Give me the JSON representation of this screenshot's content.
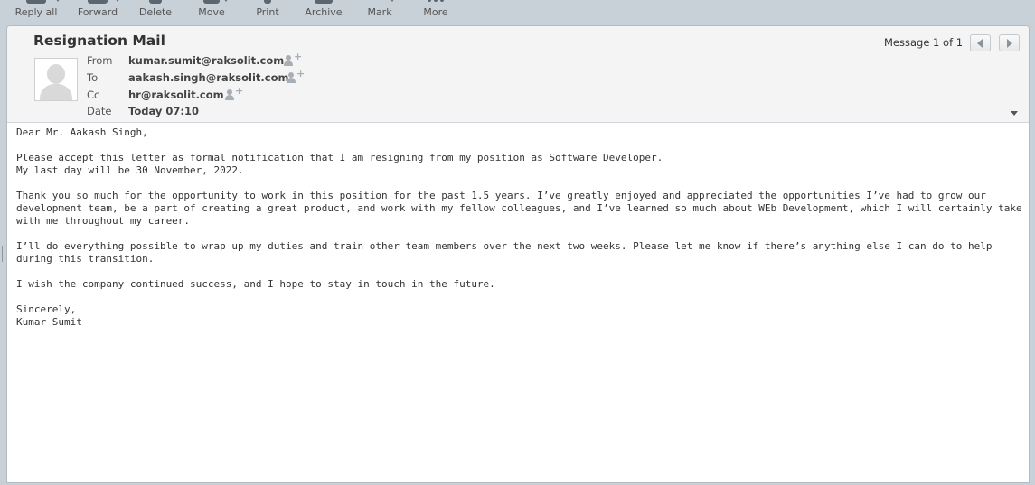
{
  "toolbar": {
    "reply_all": "Reply all",
    "forward": "Forward",
    "delete": "Delete",
    "move": "Move",
    "print": "Print",
    "archive": "Archive",
    "mark": "Mark",
    "more": "More"
  },
  "message": {
    "subject": "Resignation Mail",
    "counter": "Message 1 of 1",
    "labels": {
      "from": "From",
      "to": "To",
      "cc": "Cc",
      "date": "Date"
    },
    "from": "kumar.sumit@raksolit.com",
    "to": "aakash.singh@raksolit.com",
    "cc": "hr@raksolit.com",
    "date": "Today 07:10",
    "body": {
      "greeting": "Dear Mr. Aakash Singh,",
      "p1_line1": "Please accept this letter as formal notification that I am resigning from my position as Software Developer.",
      "p1_line2": "My last day will be 30 November, 2022.",
      "p2": "Thank you so much for the opportunity to work in this position for the past 1.5 years. I’ve greatly enjoyed and appreciated the opportunities I’ve had to grow our development team, be a part of creating a great product, and work with my fellow colleagues, and I’ve learned so much about WEb Development, which I will certainly take with me throughout my career.",
      "p3": "I’ll do everything possible to wrap up my duties and train other team members over the next two weeks. Please let me know if there’s anything else I can do to help during this transition.",
      "p4": "I wish the company continued success, and I hope to stay in touch in the future.",
      "closing": "Sincerely,",
      "signature": "Kumar Sumit"
    }
  },
  "colors": {
    "background": "#c9d1d8",
    "header_bg": "#f4f4f4",
    "icon": "#5b6670"
  }
}
